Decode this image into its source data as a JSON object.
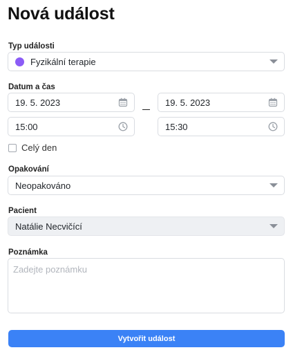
{
  "page": {
    "title": "Nová událost"
  },
  "event_type": {
    "label": "Typ události",
    "value": "Fyzikální terapie",
    "dot_color": "#8b5cf6"
  },
  "datetime": {
    "label": "Datum a čas",
    "start_date": "19. 5. 2023",
    "end_date": "19. 5. 2023",
    "start_time": "15:00",
    "end_time": "15:30",
    "all_day_label": "Celý den"
  },
  "repeat": {
    "label": "Opakování",
    "value": "Neopakováno"
  },
  "patient": {
    "label": "Pacient",
    "value": "Natálie Necvičící"
  },
  "note": {
    "label": "Poznámka",
    "placeholder": "Zadejte poznámku"
  },
  "actions": {
    "create_label": "Vytvořit událost"
  },
  "colors": {
    "accent": "#3b82f6"
  }
}
